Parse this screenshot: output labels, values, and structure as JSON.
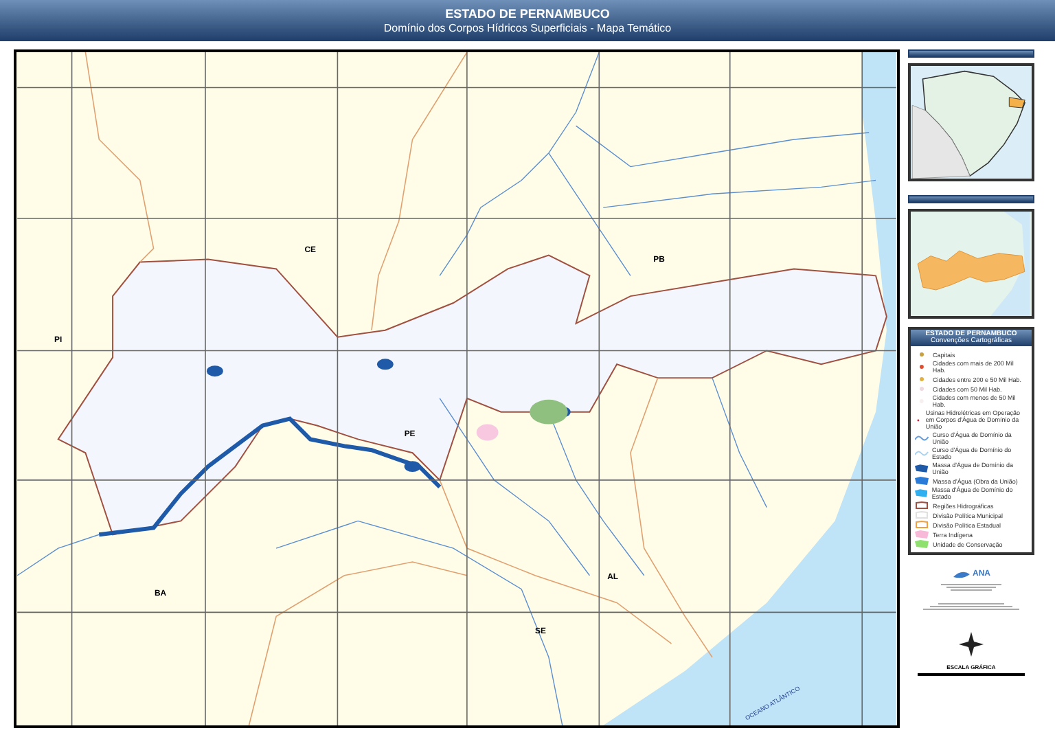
{
  "header": {
    "title": "ESTADO DE PERNAMBUCO",
    "subtitle": "Domínio dos Corpos Hídricos Superficiais - Mapa Temático"
  },
  "map": {
    "labels": [
      {
        "text": "CE",
        "kind": "state"
      },
      {
        "text": "PB",
        "kind": "state"
      },
      {
        "text": "PI",
        "kind": "state"
      },
      {
        "text": "PE",
        "kind": "state"
      },
      {
        "text": "BA",
        "kind": "state"
      },
      {
        "text": "AL",
        "kind": "state"
      },
      {
        "text": "SE",
        "kind": "state"
      },
      {
        "text": "OCEANO ATLÂNTICO",
        "kind": "ocean"
      }
    ]
  },
  "legend": {
    "title": "ESTADO DE PERNAMBUCO",
    "subtitle": "Convenções Cartográficas",
    "items": [
      {
        "kind": "dot",
        "color": "#c8a040",
        "label": "Capitais"
      },
      {
        "kind": "dot",
        "color": "#e05030",
        "label": "Cidades com mais de 200 Mil Hab."
      },
      {
        "kind": "dot",
        "color": "#e0b040",
        "label": "Cidades entre 200 e 50 Mil Hab."
      },
      {
        "kind": "dot",
        "color": "#f0d8e0",
        "label": "Cidades com 50 Mil Hab."
      },
      {
        "kind": "dot",
        "color": "#f8f0f0",
        "label": "Cidades com menos de 50 Mil Hab."
      },
      {
        "kind": "dot",
        "color": "#d02040",
        "label": "Usinas Hidrelétricas em Operação em Corpos d'Água de Domínio da União"
      },
      {
        "kind": "line",
        "color": "#6a9ed8",
        "label": "Curso d'Água de Domínio da União"
      },
      {
        "kind": "line",
        "color": "#a8d0f0",
        "label": "Curso d'Água de Domínio do Estado"
      },
      {
        "kind": "blob",
        "color": "#1f5aa8",
        "label": "Massa d'Água de Domínio da União"
      },
      {
        "kind": "blob",
        "color": "#2a7ad8",
        "label": "Massa d'Água (Obra da União)"
      },
      {
        "kind": "blob",
        "color": "#30b0f0",
        "label": "Massa d'Água de Domínio do Estado"
      },
      {
        "kind": "outline",
        "color": "#a05040",
        "label": "Regiões Hidrográficas"
      },
      {
        "kind": "outline",
        "color": "#e0e0e0",
        "label": "Divisão Política Municipal"
      },
      {
        "kind": "outline",
        "color": "#f0a040",
        "label": "Divisão Política Estadual"
      },
      {
        "kind": "blob",
        "color": "#f8b8d8",
        "label": "Terra Indígena"
      },
      {
        "kind": "blob",
        "color": "#90e070",
        "label": "Unidade de Conservação"
      }
    ]
  },
  "logo": {
    "text": "ANA"
  },
  "scale": {
    "title": "ESCALA GRÁFICA"
  }
}
